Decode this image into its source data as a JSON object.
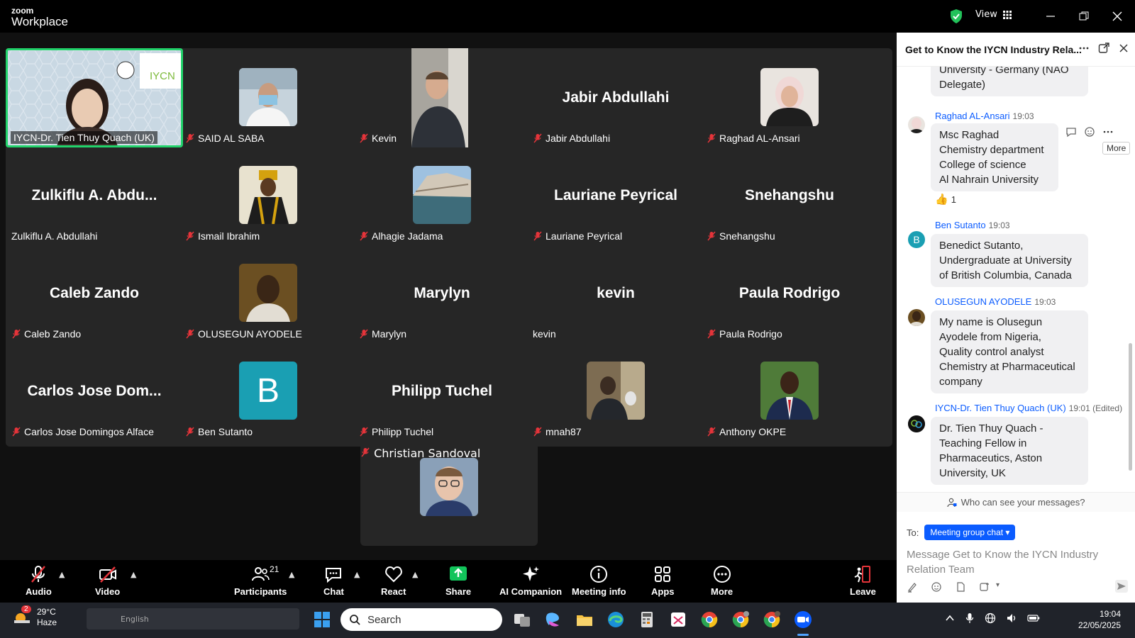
{
  "app": {
    "logo_line1": "zoom",
    "logo_line2": "Workplace",
    "view_label": "View"
  },
  "tiles": [
    {
      "id": "t0",
      "name": "IYCN-Dr. Tien Thuy Quach (UK)",
      "big": "",
      "muted": false,
      "logo_text": "IYCN"
    },
    {
      "id": "t1",
      "name": "SAID AL SABA",
      "big": "",
      "muted": true
    },
    {
      "id": "t2",
      "name": "Kevin",
      "big": "",
      "muted": true
    },
    {
      "id": "t3",
      "name": "Jabir Abdullahi",
      "big": "Jabir Abdullahi",
      "muted": true
    },
    {
      "id": "t4",
      "name": "Raghad AL-Ansari",
      "big": "",
      "muted": true
    },
    {
      "id": "t5",
      "name": "Zulkiflu A. Abdullahi",
      "big": "Zulkiflu A. Abdu...",
      "muted": false
    },
    {
      "id": "t6",
      "name": "Ismail Ibrahim",
      "big": "",
      "muted": true
    },
    {
      "id": "t7",
      "name": "Alhagie Jadama",
      "big": "",
      "muted": true
    },
    {
      "id": "t8",
      "name": "Lauriane Peyrical",
      "big": "Lauriane Peyrical",
      "muted": true
    },
    {
      "id": "t9",
      "name": "Snehangshu",
      "big": "Snehangshu",
      "muted": true
    },
    {
      "id": "t10",
      "name": "Caleb Zando",
      "big": "Caleb Zando",
      "muted": true
    },
    {
      "id": "t11",
      "name": "OLUSEGUN AYODELE",
      "big": "",
      "muted": true
    },
    {
      "id": "t12",
      "name": "Marylyn",
      "big": "Marylyn",
      "muted": true
    },
    {
      "id": "t13",
      "name": "kevin",
      "big": "kevin",
      "muted": false
    },
    {
      "id": "t14",
      "name": "Paula Rodrigo",
      "big": "Paula Rodrigo",
      "muted": true
    },
    {
      "id": "t15",
      "name": "Carlos Jose Domingos Alface",
      "big": "Carlos Jose Dom...",
      "muted": true
    },
    {
      "id": "t16",
      "name": "Ben Sutanto",
      "big": "",
      "muted": true,
      "initial": "B"
    },
    {
      "id": "t17",
      "name": "Philipp Tuchel",
      "big": "Philipp Tuchel",
      "muted": true
    },
    {
      "id": "t18",
      "name": "mnah87",
      "big": "",
      "muted": true
    },
    {
      "id": "t19",
      "name": "Anthony OKPE",
      "big": "",
      "muted": true
    },
    {
      "id": "t20",
      "name": "Christian Sandoval",
      "big": "",
      "muted": true
    }
  ],
  "toolbar": {
    "audio": "Audio",
    "video": "Video",
    "participants": "Participants",
    "participants_count": "21",
    "chat": "Chat",
    "react": "React",
    "share": "Share",
    "ai": "AI Companion",
    "info": "Meeting info",
    "apps": "Apps",
    "more": "More",
    "leave": "Leave"
  },
  "chat": {
    "title": "Get to Know the IYCN Industry Rela...",
    "more_tooltip": "More",
    "messages": [
      {
        "id": "m0",
        "sender": "",
        "time": "",
        "lines": [
          "University - Germany (NAO",
          "Delegate)"
        ]
      },
      {
        "id": "m1",
        "sender": "Raghad AL-Ansari",
        "time": "19:03",
        "lines": [
          "Msc Raghad",
          "Chemistry department",
          "College of science",
          "Al Nahrain University"
        ],
        "reaction": "1"
      },
      {
        "id": "m2",
        "sender": "Ben Sutanto",
        "time": "19:03",
        "lines": [
          "Benedict Sutanto,",
          "Undergraduate at University",
          "of British Columbia, Canada"
        ],
        "avatar_initial": "B"
      },
      {
        "id": "m3",
        "sender": "OLUSEGUN AYODELE",
        "time": "19:03",
        "lines": [
          "My name is Olusegun",
          "Ayodele from Nigeria,",
          "Quality control analyst",
          "Chemistry at Pharmaceutical",
          "company"
        ]
      },
      {
        "id": "m4",
        "sender": "IYCN-Dr. Tien Thuy Quach (UK)",
        "time": "19:01 (Edited)",
        "lines": [
          "Dr. Tien Thuy Quach -",
          "Teaching Fellow in",
          "Pharmaceutics, Aston",
          "University, UK"
        ]
      }
    ],
    "who_can_see": "Who can see your messages?",
    "to_label": "To:",
    "to_target": "Meeting group chat",
    "compose_placeholder": "Message Get to Know the IYCN Industry Relation Team"
  },
  "taskbar": {
    "weather_temp": "29°C",
    "weather_desc": "Haze",
    "weather_badge": "2",
    "lang": "English",
    "search_placeholder": "Search",
    "time": "19:04",
    "date": "22/05/2025"
  },
  "colors": {
    "accent": "#0b5cff",
    "active_speaker": "#22d36b",
    "muted_red": "#e5343a",
    "share_green": "#12c45b"
  }
}
